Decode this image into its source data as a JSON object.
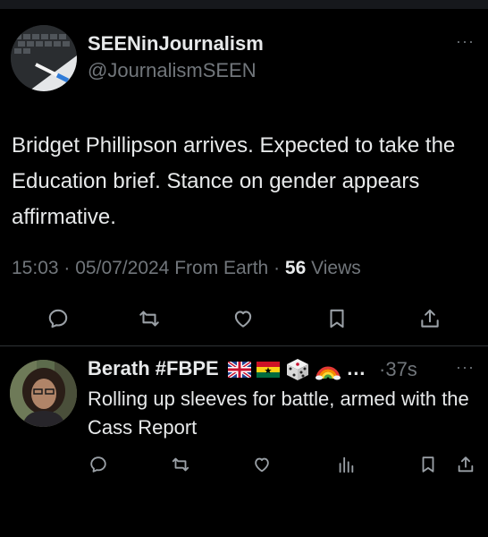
{
  "tweet": {
    "author_name": "SEENinJournalism",
    "author_handle": "@JournalismSEEN",
    "more": "···",
    "text": "Bridget Phillipson arrives.  Expected to take the Education brief. Stance on gender appears affirmative.",
    "time": "15:03",
    "separator": "·",
    "date": "05/07/2024",
    "source": "From Earth",
    "views_count": "56",
    "views_label": "Views",
    "actions": [
      "reply-icon",
      "retweet-icon",
      "like-icon",
      "bookmark-icon",
      "share-icon"
    ]
  },
  "reply": {
    "author_name": "Berath #FBPE",
    "ellipsis": "…",
    "separator": "·",
    "time": "37s",
    "more": "···",
    "text": "Rolling up sleeves for battle, armed with the Cass Report",
    "actions": [
      "reply-icon",
      "retweet-icon",
      "like-icon",
      "views-icon",
      "bookmark-icon",
      "share-icon"
    ]
  },
  "colors": {
    "background": "#000000",
    "text": "#e7e9ea",
    "muted": "#71767b",
    "divider": "#2f3336"
  }
}
